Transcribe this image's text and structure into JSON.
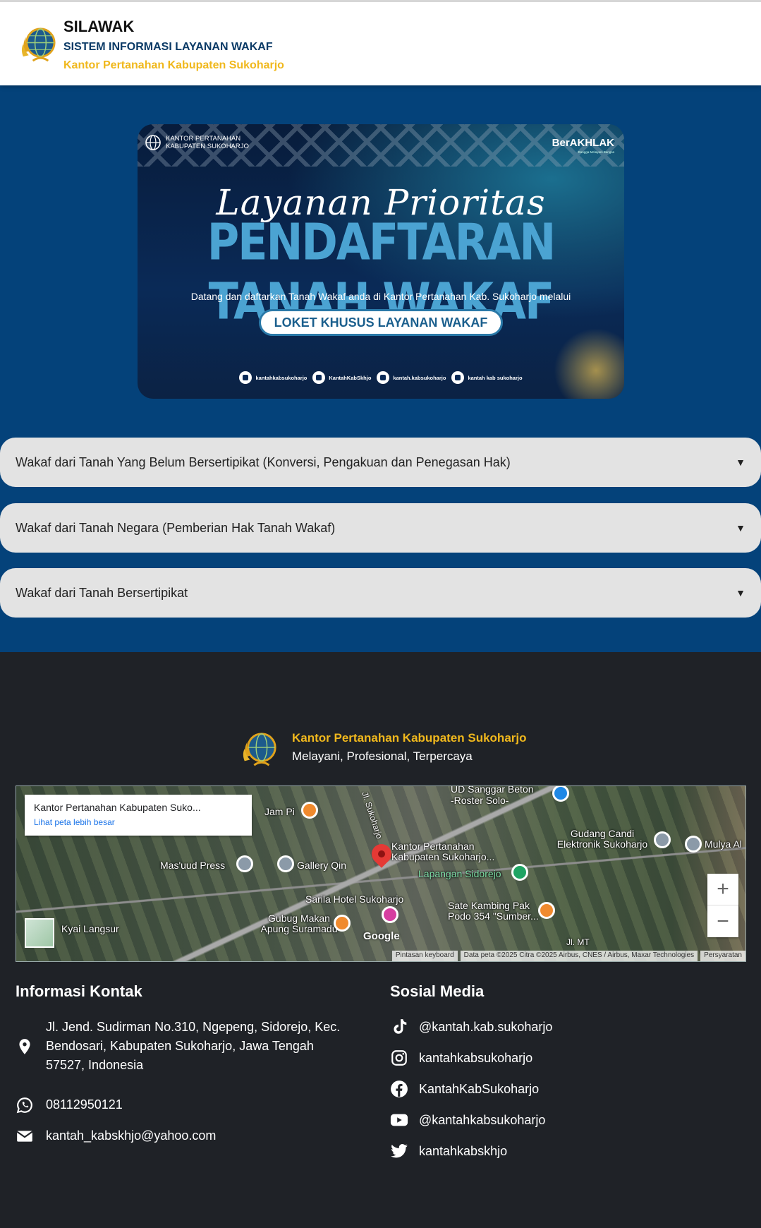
{
  "header": {
    "app_name": "SILAWAK",
    "app_subtitle": "SISTEM INFORMASI LAYANAN WAKAF",
    "office": "Kantor Pertanahan Kabupaten Sukoharjo",
    "logo_icon": "bpn-globe-logo"
  },
  "banner": {
    "org_line1": "KANTOR PERTANAHAN",
    "org_line2": "KABUPATEN SUKOHARJO",
    "badge": "BerAKHLAK",
    "badge_sub": "Bangga Melayani Bangsa",
    "script_title": "Layanan Prioritas",
    "headline": "PENDAFTARAN TANAH WAKAF",
    "description": "Datang dan daftarkan Tanah Wakaf anda di Kantor Pertanahan Kab. Sukoharjo melalui",
    "pill": "LOKET KHUSUS LAYANAN WAKAF",
    "socials": [
      {
        "icon": "instagram-icon",
        "handle": "kantahkabsukoharjo"
      },
      {
        "icon": "x-icon",
        "handle": "KantahKabSkhjo"
      },
      {
        "icon": "tiktok-icon",
        "handle": "kantah.kabsukoharjo"
      },
      {
        "icon": "youtube-icon",
        "handle": "kantah kab sukoharjo"
      }
    ]
  },
  "accordions": [
    {
      "label": "Wakaf dari Tanah Yang Belum Bersertipikat (Konversi, Pengakuan dan Penegasan Hak)",
      "arrow": "▼"
    },
    {
      "label": "Wakaf dari Tanah Negara (Pemberian Hak Tanah Wakaf)",
      "arrow": "▼"
    },
    {
      "label": "Wakaf dari Tanah Bersertipikat",
      "arrow": "▼"
    }
  ],
  "footer": {
    "office": "Kantor Pertanahan Kabupaten Sukoharjo",
    "tagline": "Melayani, Profesional, Terpercaya",
    "map": {
      "card_title": "Kantor Pertanahan Kabupaten Suko...",
      "card_link": "Lihat peta lebih besar",
      "labels": {
        "sanggar": "UD Sanggar Beton -Roster Solo-",
        "jampi": "Jam Pi",
        "road": "Jl. Sukoharjo",
        "kantor": "Kantor Pertanahan Kabupaten Sukoharjo...",
        "gudang": "Gudang Candi Elektronik Sukoharjo",
        "mulya": "Mulya Al",
        "masuud": "Mas'uud Press",
        "gallery": "Gallery Qin",
        "lapangan": "Lapangan Sidorejo",
        "sarila": "Sarila Hotel Sukoharjo",
        "sate": "Sate Kambing Pak Podo 354 \"Sumber...",
        "gubug": "Gubug Makan Apung Suramadu",
        "kyai": "Kyai Langsur",
        "jlmt": "Jl. MT"
      },
      "zoom_in": "+",
      "zoom_out": "−",
      "google": "Google",
      "attribution": [
        "Pintasan keyboard",
        "Data peta ©2025 Citra ©2025 Airbus, CNES / Airbus, Maxar Technologies",
        "Persyaratan"
      ]
    },
    "contact": {
      "heading": "Informasi Kontak",
      "address": "Jl. Jend. Sudirman No.310, Ngepeng, Sidorejo, Kec. Bendosari, Kabupaten Sukoharjo, Jawa Tengah 57527, Indonesia",
      "phone": "08112950121",
      "email": "kantah_kabskhjo@yahoo.com"
    },
    "social": {
      "heading": "Sosial Media",
      "tiktok": "@kantah.kab.sukoharjo",
      "instagram": "kantahkabsukoharjo",
      "facebook": "KantahKabSukoharjo",
      "youtube": "@kantahkabsukoharjo",
      "twitter": "kantahkabskhjo"
    }
  },
  "colors": {
    "header_bg": "#ffffff",
    "page_bg": "#04427a",
    "accent_yellow": "#f0b81d",
    "accordion_bg": "#e3e3e3",
    "footer_bg": "#1f2227"
  }
}
